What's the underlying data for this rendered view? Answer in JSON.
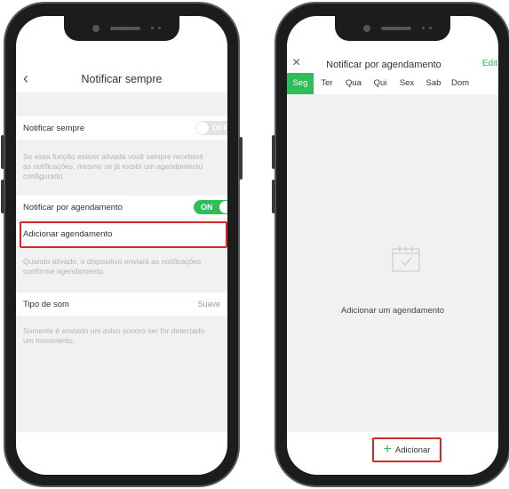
{
  "left": {
    "nav_title": "Notificar sempre",
    "back_icon": "‹",
    "always": {
      "label": "Notificar sempre",
      "toggle": "OFF",
      "desc": [
        "Se essa função estiver ativada você sempre receberá",
        "as notificações, mesmo se já existir um agendamento",
        "configurado."
      ]
    },
    "schedule": {
      "label": "Notificar por agendamento",
      "toggle": "ON"
    },
    "add_schedule": "Adicionar agendamento",
    "schedule_desc": [
      "Quando ativado, o dispositivo enviará as notificações",
      "conforme agendamento."
    ],
    "sound": {
      "label": "Tipo de som",
      "value": "Suave"
    },
    "sound_desc": [
      "Somente é enviado um aviso sonoro ser for detectado",
      "um movimento."
    ]
  },
  "right": {
    "nav_title": "Notificar por agendamento",
    "close_icon": "×",
    "edit": "Editar",
    "days": [
      "Seg",
      "Ter",
      "Qua",
      "Qui",
      "Sex",
      "Sab",
      "Dom"
    ],
    "active_day": "Seg",
    "empty_text": "Adicionar um agendamento",
    "add_button": "Adicionar",
    "add_icon": "+"
  },
  "colors": {
    "accent": "#2dbd59",
    "highlight": "#d62828",
    "background": "#f1f1f3"
  }
}
